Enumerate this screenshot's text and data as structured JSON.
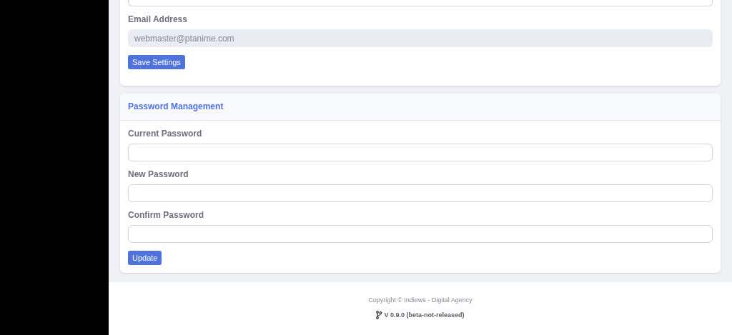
{
  "settings_card": {
    "fields": [
      {
        "label": "Email Address",
        "value": "webmaster@ptanime.com",
        "disabled": true
      }
    ],
    "button": "Save Settings"
  },
  "password_card": {
    "title": "Password Management",
    "fields": [
      {
        "label": "Current Password",
        "disabled": false
      },
      {
        "label": "New Password",
        "disabled": false
      },
      {
        "label": "Confirm Password",
        "disabled": false
      }
    ],
    "button": "Update"
  },
  "footer": {
    "copyright": "Copyright © Indiews - Digital Agency",
    "version": "V 0.9.0 (beta-not-released)"
  }
}
